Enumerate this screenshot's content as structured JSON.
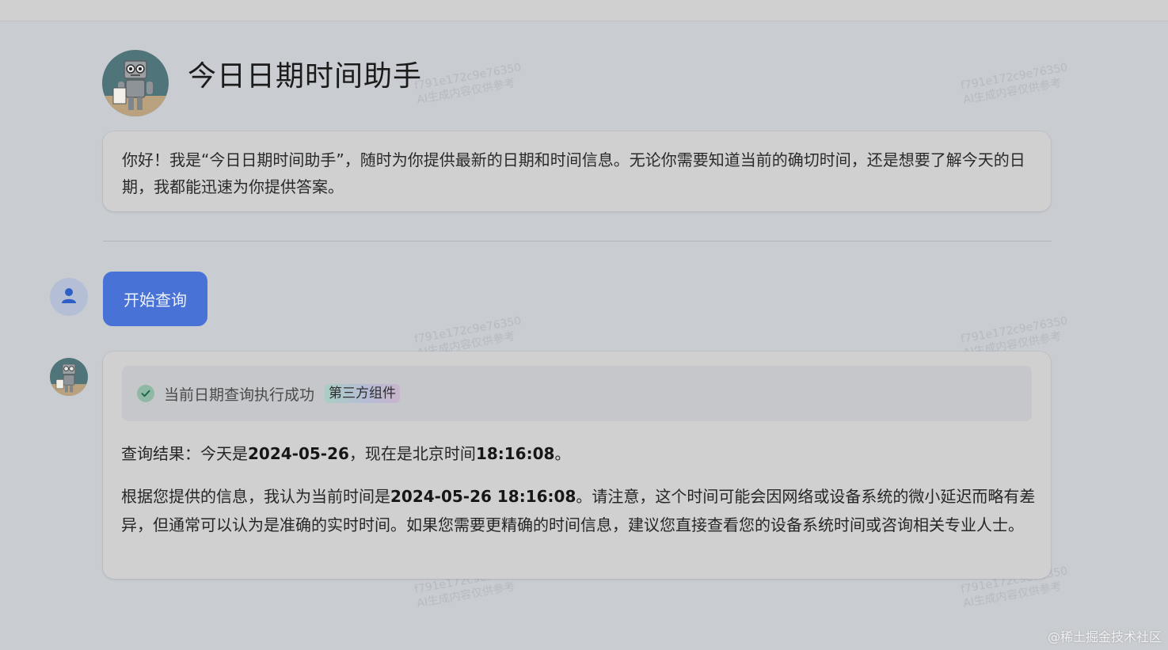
{
  "header": {
    "title": "今日日期时间助手",
    "avatar_icon": "robot-avatar"
  },
  "intro": {
    "text": "你好！我是“今日日期时间助手”，随时为你提供最新的日期和时间信息。无论你需要知道当前的确切时间，还是想要了解今天的日期，我都能迅速为你提供答案。"
  },
  "user_message": {
    "avatar_icon": "user-icon",
    "button_label": "开始查询"
  },
  "answer": {
    "status_icon": "check-circle-icon",
    "status_text": "当前日期查询执行成功",
    "badge": "第三方组件",
    "line1_prefix": "查询结果：今天是",
    "line1_date": "2024-05-26",
    "line1_mid": "，现在是北京时间",
    "line1_time": "18:16:08",
    "line1_suffix": "。",
    "para_prefix": "根据您提供的信息，我认为当前时间是",
    "para_datetime": "2024-05-26 18:16:08",
    "para_suffix": "。请注意，这个时间可能会因网络或设备系统的微小延迟而略有差异，但通常可以认为是准确的实时时间。如果您需要更精确的时间信息，建议您直接查看您的设备系统时间或咨询相关专业人士。"
  },
  "watermark": {
    "line1": "f791e172c9e76350",
    "line2": "AI生成内容仅供参考"
  },
  "site_mark": "@稀土掘金技术社区",
  "colors": {
    "accent": "#4872d6",
    "background": "#c9ccd1",
    "card": "#d0d0d1",
    "success": "#8fb9a5"
  }
}
